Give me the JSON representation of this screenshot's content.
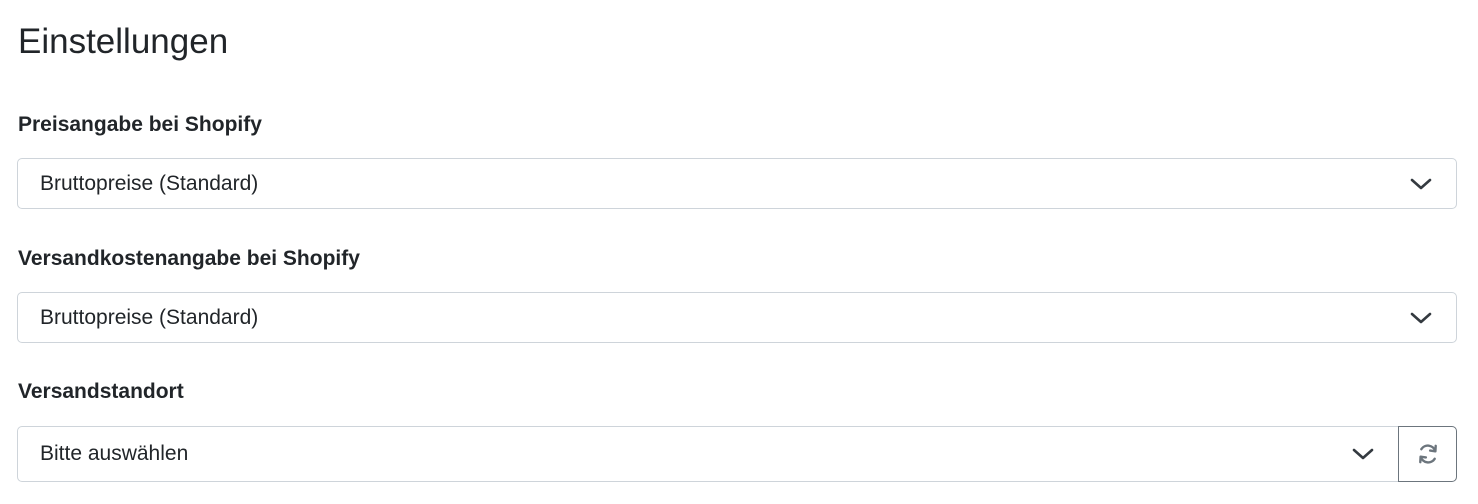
{
  "settings": {
    "title": "Einstellungen",
    "price_display": {
      "label": "Preisangabe bei Shopify",
      "selected": "Bruttopreise (Standard)"
    },
    "shipping_cost_display": {
      "label": "Versandkostenangabe bei Shopify",
      "selected": "Bruttopreise (Standard)"
    },
    "shipping_location": {
      "label": "Versandstandort",
      "selected": "Bitte auswählen",
      "refresh_icon": "refresh-icon"
    }
  },
  "colors": {
    "text": "#212529",
    "border": "#ced4da",
    "button_border": "#6c757d",
    "background": "#ffffff"
  },
  "icons": {
    "dropdown": "chevron-down-icon",
    "refresh": "refresh-icon"
  }
}
